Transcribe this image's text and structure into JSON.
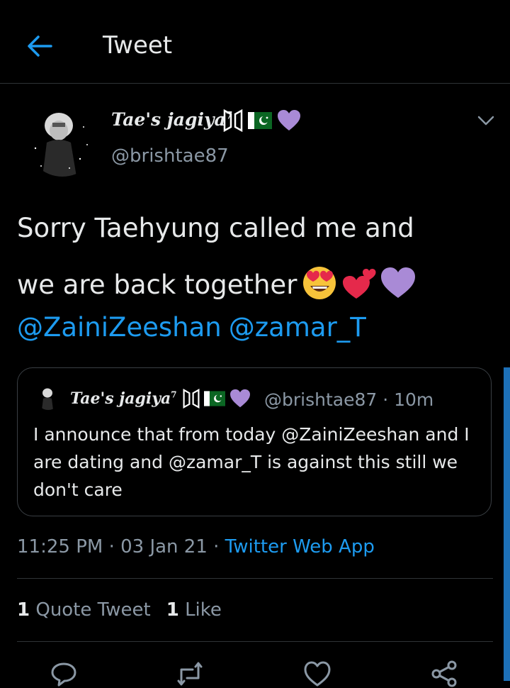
{
  "header": {
    "title": "Tweet",
    "back_icon": "arrow-left-icon"
  },
  "author": {
    "display_name": "Tae's jagiya",
    "display_name_sup": "7",
    "badges": [
      "bts-logo-icon",
      "pakistan-flag-icon",
      "purple-heart-icon"
    ],
    "handle": "@brishtae87"
  },
  "tweet": {
    "lines": [
      "Sorry Taehyung called me and",
      "we are back together"
    ],
    "emojis": [
      "heart-eyes-emoji",
      "two-hearts-emoji",
      "purple-heart-emoji"
    ],
    "mentions": [
      "@ZainiZeeshan",
      "@zamar_T"
    ]
  },
  "quote": {
    "display_name": "Tae's jagiya",
    "display_name_sup": "7",
    "meta": "@brishtae87 · 10m",
    "text": "I announce that from today @ZainiZeeshan and I are dating and @zamar_T  is against this still we don't care"
  },
  "timestamp": {
    "time": "11:25 PM · 03 Jan 21 · ",
    "source": "Twitter Web App"
  },
  "stats": {
    "quote_count": "1",
    "quote_label": "Quote Tweet",
    "like_count": "1",
    "like_label": "Like"
  },
  "actions": [
    "reply-icon",
    "retweet-icon",
    "like-icon",
    "share-icon"
  ],
  "colors": {
    "accent": "#1d9bf0",
    "background": "#000000",
    "secondary_text": "#8b98a5",
    "purple_heart": "#a98ad6"
  }
}
